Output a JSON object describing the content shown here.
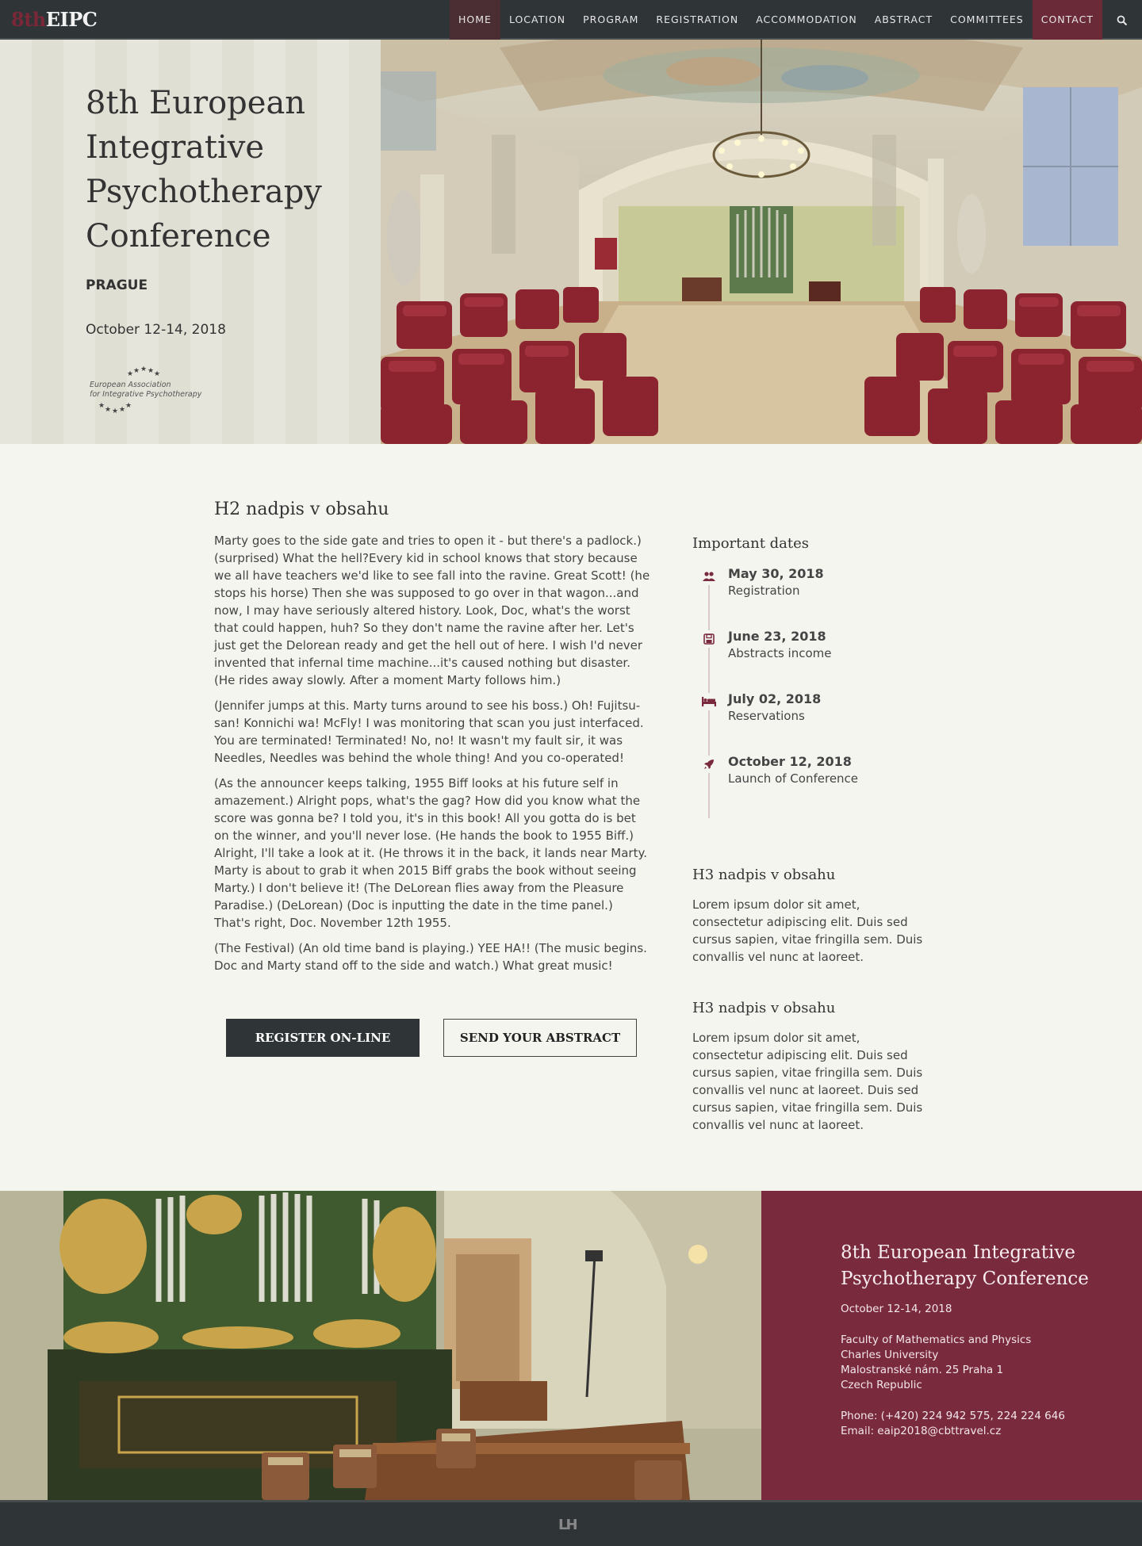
{
  "nav": {
    "logo_prefix": "8th",
    "logo_main": "EIPC",
    "items": [
      {
        "label": "HOME"
      },
      {
        "label": "LOCATION"
      },
      {
        "label": "PROGRAM"
      },
      {
        "label": "REGISTRATION"
      },
      {
        "label": "ACCOMMODATION"
      },
      {
        "label": "ABSTRACT"
      },
      {
        "label": "COMMITTEES"
      },
      {
        "label": "CONTACT"
      }
    ],
    "search_icon": "search-icon"
  },
  "hero": {
    "title": "8th European Integrative Psychotherapy Conference",
    "city": "PRAGUE",
    "date": "October 12-14, 2018",
    "association_line1": "European Association",
    "association_line2": "for Integrative Psychotherapy"
  },
  "main": {
    "heading": "H2 nadpis v obsahu",
    "paragraphs": [
      "Marty goes to the side gate and tries to open it - but there's a padlock.) (surprised) What the hell?Every kid in school knows that story because we all have teachers we'd like to see fall into the ravine. Great Scott! (he stops his horse) Then she was supposed to go over in that wagon...and now, I may have seriously altered history. Look, Doc, what's the worst that could happen, huh? So they don't name the ravine after her. Let's just get the Delorean ready and get the hell out of here. I wish I'd never invented that infernal time machine...it's caused nothing but disaster. (He rides away slowly. After a moment Marty follows him.)",
      "(Jennifer jumps at this. Marty turns around to see his boss.) Oh! Fujitsu-san! Konnichi wa! McFly! I was monitoring that scan you just interfaced. You are terminated! Terminated! No, no! It wasn't my fault sir, it was Needles, Needles was behind the whole thing! And you co-operated!",
      "(As the announcer keeps talking, 1955 Biff looks at his future self in amazement.) Alright pops, what's the gag? How did you know what the score was gonna be? I told you, it's in this book! All you gotta do is bet on the winner, and you'll never lose. (He hands the book to 1955 Biff.) Alright, I'll take a look at it. (He throws it in the back, it lands near Marty. Marty is about to grab it when 2015 Biff grabs the book without seeing Marty.) I don't believe it! (The DeLorean flies away from the Pleasure Paradise.) (DeLorean) (Doc is inputting the date in the time panel.) That's right, Doc. November 12th 1955.",
      "(The Festival) (An old time band is playing.) YEE HA!! (The music begins. Doc and Marty stand off to the side and watch.) What great music!"
    ],
    "register_button": "REGISTER ON-LINE",
    "abstract_button": "SEND YOUR ABSTRACT"
  },
  "sidebar": {
    "dates_heading": "Important dates",
    "dates": [
      {
        "date": "May 30, 2018",
        "label": "Registration",
        "icon": "users-icon"
      },
      {
        "date": "June 23, 2018",
        "label": "Abstracts income",
        "icon": "floppy-icon"
      },
      {
        "date": "July 02, 2018",
        "label": "Reservations",
        "icon": "bed-icon"
      },
      {
        "date": "October 12, 2018",
        "label": "Launch of Conference",
        "icon": "rocket-icon"
      }
    ],
    "block1_heading": "H3 nadpis v obsahu",
    "block1_text": "Lorem ipsum dolor sit amet, consectetur adipiscing elit. Duis sed cursus sapien, vitae fringilla sem. Duis convallis vel nunc at laoreet.",
    "block2_heading": "H3 nadpis v obsahu",
    "block2_text": "Lorem ipsum dolor sit amet, consectetur adipiscing elit. Duis sed cursus sapien, vitae fringilla sem. Duis convallis vel nunc at laoreet. Duis sed cursus sapien, vitae fringilla sem. Duis convallis vel nunc at laoreet."
  },
  "banner": {
    "title": "8th European Integrative Psychotherapy Conference",
    "date": "October 12-14, 2018",
    "address_line1": "Faculty of Mathematics and Physics",
    "address_line2": "Charles University",
    "address_line3": "Malostranské nám. 25 Praha 1",
    "address_line4": "Czech Republic",
    "phone": "Phone: (+420) 224 942 575, 224 224 646",
    "email": "Email: eaip2018@cbttravel.cz"
  },
  "footer": {
    "logo": "LH"
  },
  "colors": {
    "nav_bg": "#2f3437",
    "accent": "#7a2a3d",
    "page_bg": "#f5f5f0"
  }
}
